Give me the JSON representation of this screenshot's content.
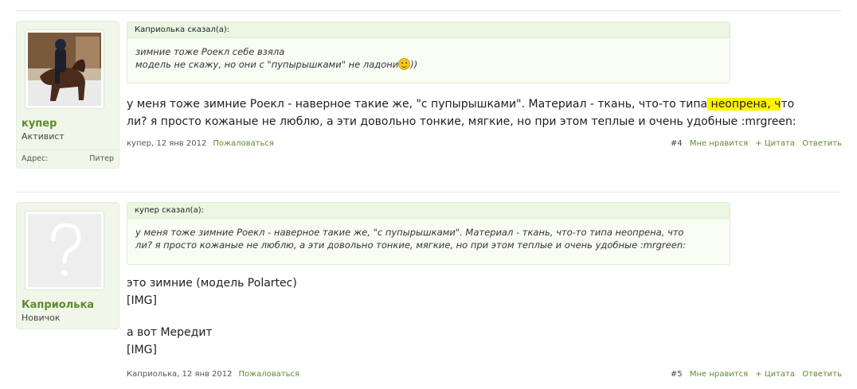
{
  "posts": [
    {
      "user": {
        "name": "купер",
        "title": "Активист",
        "extra_label": "Адрес:",
        "extra_value": "Питер"
      },
      "quote": {
        "header": "Каприолька сказал(а):",
        "line1": "зимние тоже Роекл себе взяла",
        "line2": "модель не скажу, но они с \"пупырышками\" не ладони",
        "line2_after": "))"
      },
      "message": {
        "line1_before": "у меня тоже зимние Роекл - наверное такие же, \"с пупырышками\". Материал - ткань, что-то типа",
        "line1_highlight": " неопрена, ч",
        "line1_after": "то",
        "line2": "ли? я просто кожаные не люблю, а эти довольно тонкие, мягкие, но при этом теплые и очень удобные :mrgreen:"
      },
      "meta": {
        "author_date": "купер, 12 янв 2012",
        "report": "Пожаловаться",
        "number": "#4",
        "like": "Мне нравится",
        "quote": "+ Цитата",
        "reply": "Ответить"
      }
    },
    {
      "user": {
        "name": "Каприолька",
        "title": "Новичок"
      },
      "quote": {
        "header": "купер сказал(а):",
        "line1": "у меня тоже зимние Роекл - наверное такие же, \"с пупырышками\". Материал - ткань, что-то типа неопрена, что",
        "line2": "ли? я просто кожаные не люблю, а эти довольно тонкие, мягкие, но при этом теплые и очень удобные :mrgreen:"
      },
      "message": {
        "line1": "это зимние (модель Polartec)",
        "line2": "[IMG]",
        "line3": "а вот Мередит",
        "line4": "[IMG]"
      },
      "meta": {
        "author_date": "Каприолька, 12 янв 2012",
        "report": "Пожаловаться",
        "number": "#5",
        "like": "Мне нравится",
        "quote": "+ Цитата",
        "reply": "Ответить"
      }
    }
  ],
  "icons": {
    "smiley": "smiley-icon",
    "default_avatar": "question-mark-avatar"
  },
  "colors": {
    "username": "#5d8a2d",
    "panel_bg": "#f0f7ea",
    "highlight": "#fff200"
  }
}
